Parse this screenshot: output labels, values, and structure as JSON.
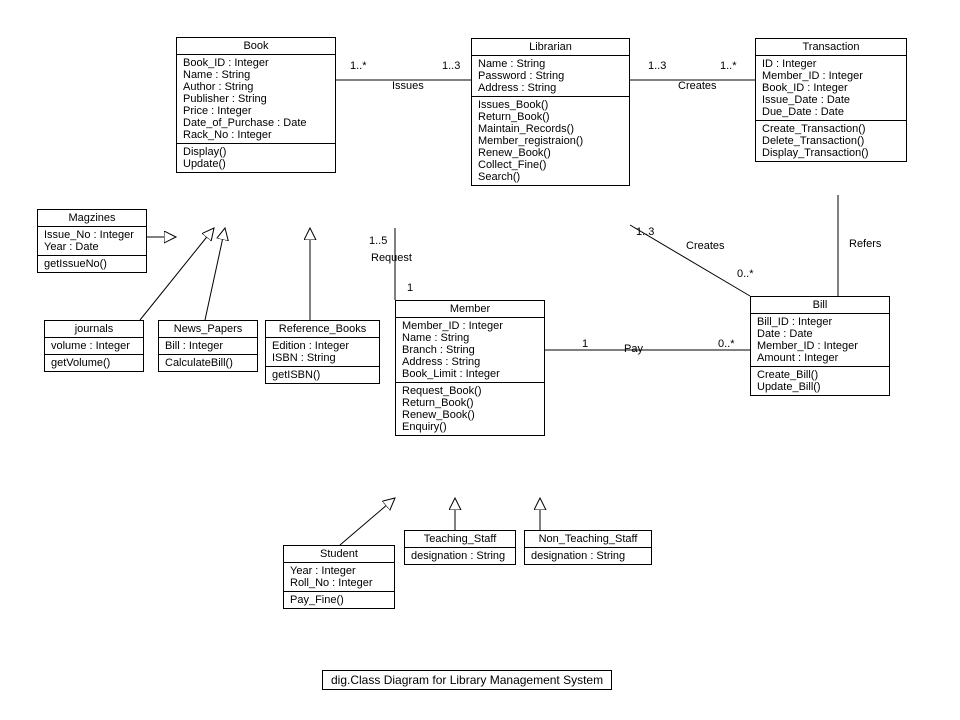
{
  "caption": "dig.Class Diagram for Library Management System",
  "classes": {
    "book": {
      "name": "Book",
      "attrs": [
        "Book_ID : Integer",
        "Name : String",
        "Author : String",
        "Publisher : String",
        "Price : Integer",
        "Date_of_Purchase : Date",
        "Rack_No : Integer"
      ],
      "ops": [
        "Display()",
        "Update()"
      ]
    },
    "magazines": {
      "name": "Magzines",
      "attrs": [
        "Issue_No : Integer",
        "Year : Date"
      ],
      "ops": [
        "getIssueNo()"
      ]
    },
    "journals": {
      "name": "journals",
      "attrs": [
        "volume : Integer"
      ],
      "ops": [
        "getVolume()"
      ]
    },
    "newspapers": {
      "name": "News_Papers",
      "attrs": [
        "Bill : Integer"
      ],
      "ops": [
        "CalculateBill()"
      ]
    },
    "refbooks": {
      "name": "Reference_Books",
      "attrs": [
        "Edition : Integer",
        "ISBN : String"
      ],
      "ops": [
        "getISBN()"
      ]
    },
    "librarian": {
      "name": "Librarian",
      "attrs": [
        "Name : String",
        "Password : String",
        "Address : String"
      ],
      "ops": [
        "Issues_Book()",
        "Return_Book()",
        "Maintain_Records()",
        "Member_registraion()",
        "Renew_Book()",
        "Collect_Fine()",
        "Search()"
      ]
    },
    "transaction": {
      "name": "Transaction",
      "attrs": [
        "ID : Integer",
        "Member_ID : Integer",
        "Book_ID : Integer",
        "Issue_Date : Date",
        "Due_Date : Date"
      ],
      "ops": [
        "Create_Transaction()",
        "Delete_Transaction()",
        "Display_Transaction()"
      ]
    },
    "bill": {
      "name": "Bill",
      "attrs": [
        "Bill_ID : Integer",
        "Date : Date",
        "Member_ID : Integer",
        "Amount : Integer"
      ],
      "ops": [
        "Create_Bill()",
        "Update_Bill()"
      ]
    },
    "member": {
      "name": "Member",
      "attrs": [
        "Member_ID : Integer",
        "Name : String",
        "Branch : String",
        "Address : String",
        "Book_Limit : Integer"
      ],
      "ops": [
        "Request_Book()",
        "Return_Book()",
        "Renew_Book()",
        "Enquiry()"
      ]
    },
    "student": {
      "name": "Student",
      "attrs": [
        "Year : Integer",
        "Roll_No : Integer"
      ],
      "ops": [
        "Pay_Fine()"
      ]
    },
    "teaching": {
      "name": "Teaching_Staff",
      "attrs": [
        "designation : String"
      ],
      "ops": []
    },
    "nonteaching": {
      "name": "Non_Teaching_Staff",
      "attrs": [
        "designation : String"
      ],
      "ops": []
    }
  },
  "labels": {
    "issues": "Issues",
    "issues_left": "1..*",
    "issues_right": "1..3",
    "creates1": "Creates",
    "creates1_left": "1..3",
    "creates1_right": "1..*",
    "request": "Request",
    "request_top": "1..5",
    "request_bottom": "1",
    "creates2": "Creates",
    "creates2_top": "1..3",
    "creates2_bottom": "0..*",
    "refers": "Refers",
    "pay": "Pay",
    "pay_left": "1",
    "pay_right": "0..*"
  }
}
